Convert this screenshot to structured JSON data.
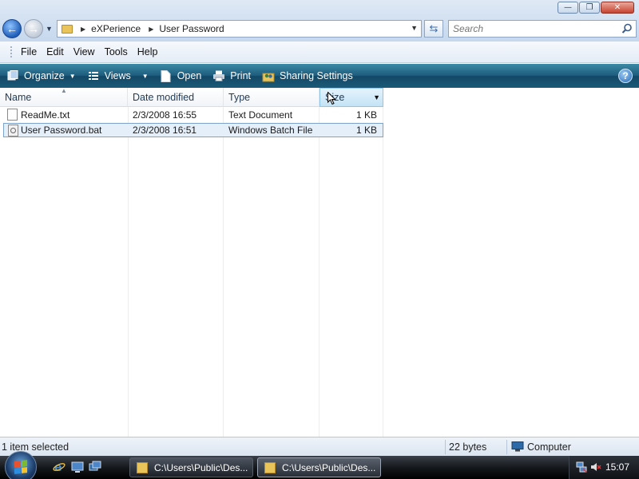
{
  "window": {
    "buttons": {
      "minimize": "—",
      "maximize": "❐",
      "close": "✕"
    }
  },
  "address_bar": {
    "crumbs": [
      "eXPerience",
      "User Password"
    ]
  },
  "search": {
    "placeholder": "Search"
  },
  "menu": [
    "File",
    "Edit",
    "View",
    "Tools",
    "Help"
  ],
  "toolbar": {
    "organize": "Organize",
    "views": "Views",
    "open": "Open",
    "print": "Print",
    "sharing": "Sharing Settings",
    "help": "?"
  },
  "columns": {
    "name": "Name",
    "date": "Date modified",
    "type": "Type",
    "size": "Size"
  },
  "files": [
    {
      "name": "ReadMe.txt",
      "date": "2/3/2008 16:55",
      "type": "Text Document",
      "size": "1 KB",
      "icon": "text-file-icon"
    },
    {
      "name": "User Password.bat",
      "date": "2/3/2008 16:51",
      "type": "Windows Batch File",
      "size": "1 KB",
      "icon": "batch-file-icon",
      "selected": true
    }
  ],
  "status": {
    "selection": "1 item selected",
    "size": "22 bytes",
    "location": "Computer"
  },
  "taskbar": {
    "tasks": [
      "C:\\Users\\Public\\Des...",
      "C:\\Users\\Public\\Des..."
    ],
    "clock": "15:07"
  },
  "colors": {
    "command_bar": "#1e5d7e",
    "selection": "#e5eff9",
    "selection_border": "#7da2ce"
  }
}
